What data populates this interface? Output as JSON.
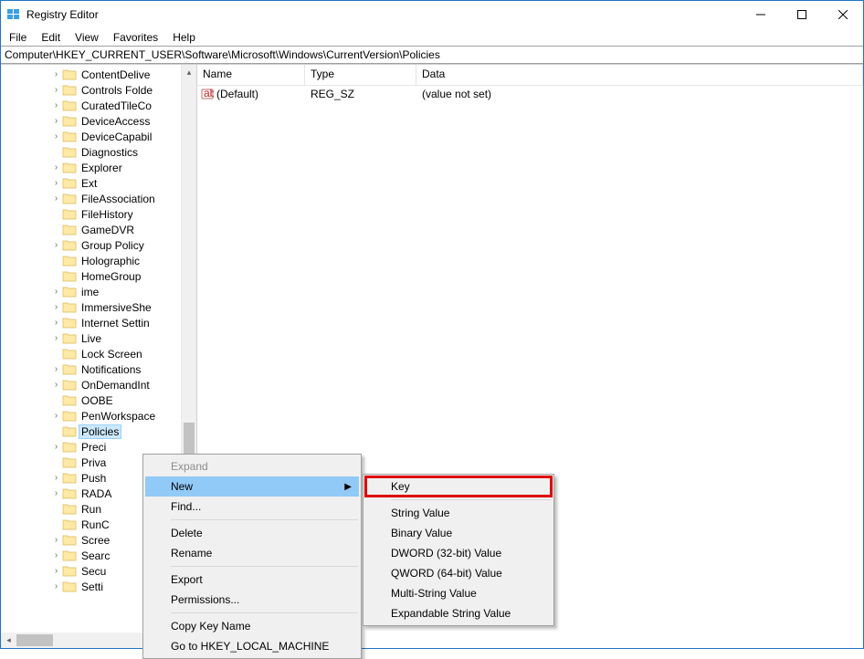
{
  "window": {
    "title": "Registry Editor"
  },
  "menu": {
    "file": "File",
    "edit": "Edit",
    "view": "View",
    "favorites": "Favorites",
    "help": "Help"
  },
  "address": "Computer\\HKEY_CURRENT_USER\\Software\\Microsoft\\Windows\\CurrentVersion\\Policies",
  "tree_items": [
    {
      "label": "ContentDelive",
      "expandable": true
    },
    {
      "label": "Controls Folde",
      "expandable": true
    },
    {
      "label": "CuratedTileCo",
      "expandable": true
    },
    {
      "label": "DeviceAccess",
      "expandable": true
    },
    {
      "label": "DeviceCapabil",
      "expandable": true
    },
    {
      "label": "Diagnostics",
      "expandable": false
    },
    {
      "label": "Explorer",
      "expandable": true
    },
    {
      "label": "Ext",
      "expandable": true
    },
    {
      "label": "FileAssociation",
      "expandable": true
    },
    {
      "label": "FileHistory",
      "expandable": false
    },
    {
      "label": "GameDVR",
      "expandable": false
    },
    {
      "label": "Group Policy",
      "expandable": true
    },
    {
      "label": "Holographic",
      "expandable": false
    },
    {
      "label": "HomeGroup",
      "expandable": false
    },
    {
      "label": "ime",
      "expandable": true
    },
    {
      "label": "ImmersiveShe",
      "expandable": true
    },
    {
      "label": "Internet Settin",
      "expandable": true
    },
    {
      "label": "Live",
      "expandable": true
    },
    {
      "label": "Lock Screen",
      "expandable": false
    },
    {
      "label": "Notifications",
      "expandable": true
    },
    {
      "label": "OnDemandInt",
      "expandable": true
    },
    {
      "label": "OOBE",
      "expandable": false
    },
    {
      "label": "PenWorkspace",
      "expandable": true
    },
    {
      "label": "Policies",
      "expandable": false,
      "selected": true
    },
    {
      "label": "Preci",
      "expandable": true
    },
    {
      "label": "Priva",
      "expandable": false
    },
    {
      "label": "Push",
      "expandable": true
    },
    {
      "label": "RADA",
      "expandable": true
    },
    {
      "label": "Run",
      "expandable": false
    },
    {
      "label": "RunC",
      "expandable": false
    },
    {
      "label": "Scree",
      "expandable": true
    },
    {
      "label": "Searc",
      "expandable": true
    },
    {
      "label": "Secu",
      "expandable": true
    },
    {
      "label": "Setti",
      "expandable": true
    }
  ],
  "list": {
    "cols": {
      "name": "Name",
      "type": "Type",
      "data": "Data"
    },
    "rows": [
      {
        "name": "(Default)",
        "type": "REG_SZ",
        "data": "(value not set)"
      }
    ]
  },
  "context_main": [
    {
      "kind": "item",
      "label": "Expand",
      "disabled": true
    },
    {
      "kind": "item",
      "label": "New",
      "submenu": true,
      "highlight": true
    },
    {
      "kind": "item",
      "label": "Find..."
    },
    {
      "kind": "sep"
    },
    {
      "kind": "item",
      "label": "Delete"
    },
    {
      "kind": "item",
      "label": "Rename"
    },
    {
      "kind": "sep"
    },
    {
      "kind": "item",
      "label": "Export"
    },
    {
      "kind": "item",
      "label": "Permissions..."
    },
    {
      "kind": "sep"
    },
    {
      "kind": "item",
      "label": "Copy Key Name"
    },
    {
      "kind": "item",
      "label": "Go to HKEY_LOCAL_MACHINE"
    }
  ],
  "context_sub": [
    {
      "kind": "item",
      "label": "Key",
      "boxed": true
    },
    {
      "kind": "sep"
    },
    {
      "kind": "item",
      "label": "String Value"
    },
    {
      "kind": "item",
      "label": "Binary Value"
    },
    {
      "kind": "item",
      "label": "DWORD (32-bit) Value"
    },
    {
      "kind": "item",
      "label": "QWORD (64-bit) Value"
    },
    {
      "kind": "item",
      "label": "Multi-String Value"
    },
    {
      "kind": "item",
      "label": "Expandable String Value"
    }
  ]
}
